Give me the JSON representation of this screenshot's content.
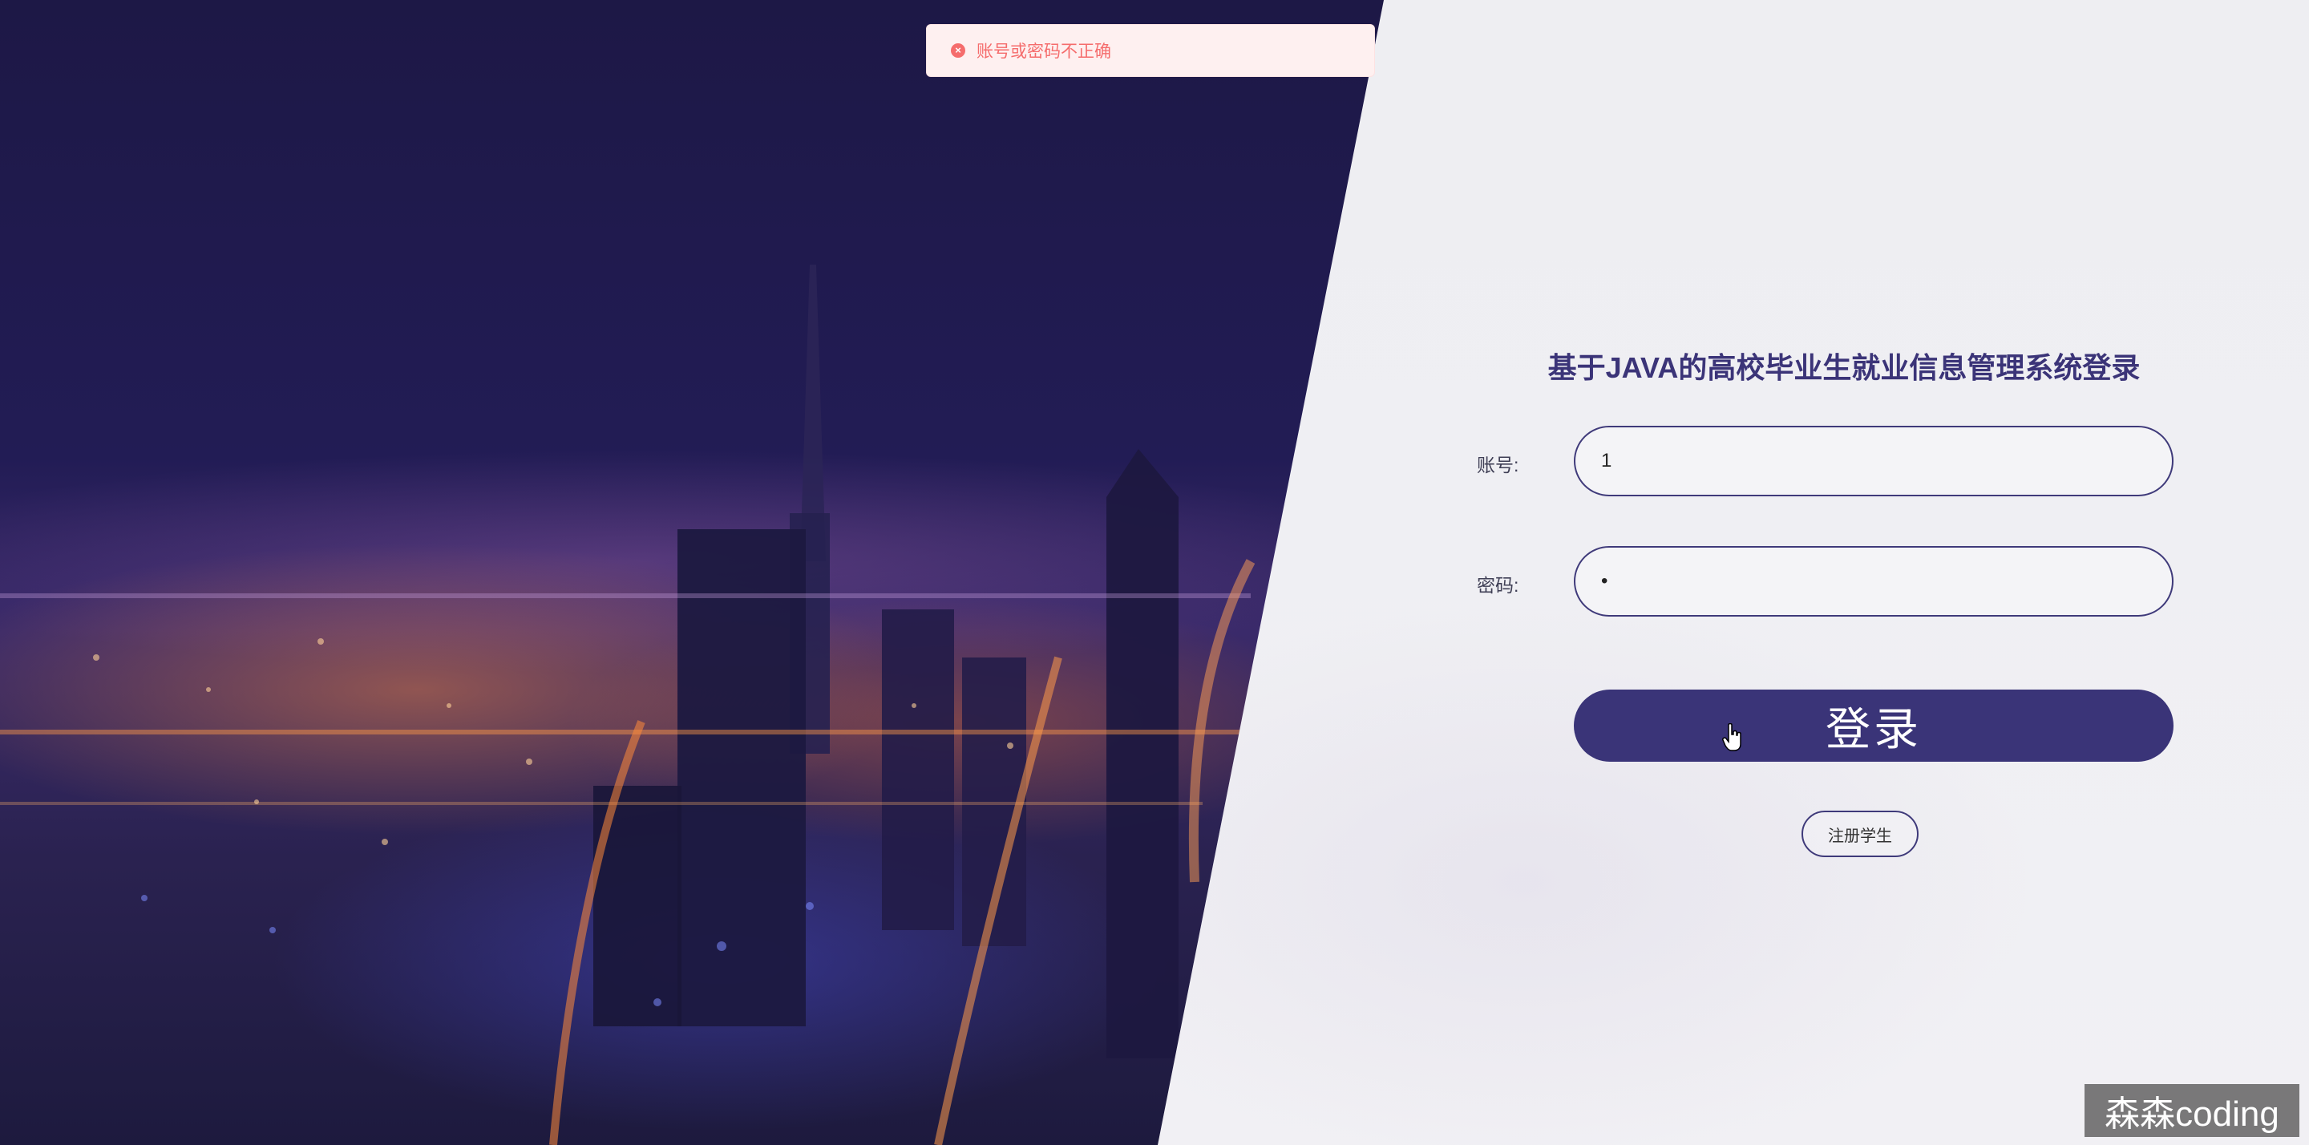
{
  "alert": {
    "icon": "error-circle-icon",
    "message": "账号或密码不正确"
  },
  "login": {
    "title": "基于JAVA的高校毕业生就业信息管理系统登录",
    "account_label": "账号:",
    "account_value": "1",
    "password_label": "密码:",
    "password_value": "•",
    "submit_label": "登录",
    "register_label": "注册学生"
  },
  "watermark": "森森coding",
  "colors": {
    "accent": "#3a3478",
    "error": "#f56c6c",
    "panel": "#eeeef2"
  }
}
